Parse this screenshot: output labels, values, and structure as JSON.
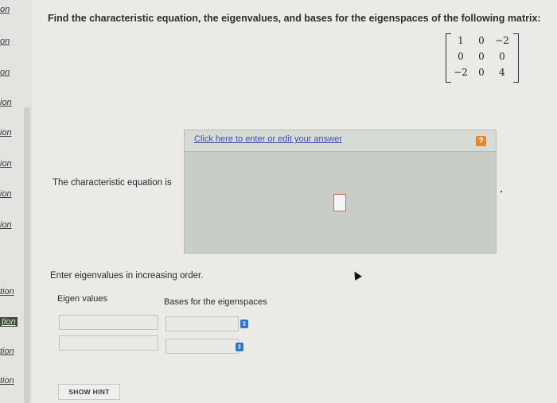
{
  "sidebar": {
    "items": [
      "on",
      "on",
      "on",
      "ion",
      "ion",
      "ion",
      "ion",
      "ion",
      "tion",
      "tion",
      "tion",
      "tion"
    ]
  },
  "question": {
    "text": "Find the characteristic equation, the eigenvalues, and bases for the eigenspaces of the following matrix:"
  },
  "matrix": {
    "rows": [
      [
        "1",
        "0",
        "−2"
      ],
      [
        "0",
        "0",
        "0"
      ],
      [
        "−2",
        "0",
        "4"
      ]
    ]
  },
  "answer": {
    "link_text": "Click here to enter or edit your answer",
    "help_label": "?"
  },
  "labels": {
    "characteristic": "The characteristic equation is",
    "instruction": "Enter eigenvalues in increasing order.",
    "eigen_values_header": "Eigen values",
    "bases_header": "Bases for the eigenspaces"
  },
  "hint": {
    "label": "SHOW HINT"
  },
  "colors": {
    "accent_blue": "#2f77c5",
    "help_orange": "#e8862e",
    "link_blue": "#3b4fa8"
  }
}
